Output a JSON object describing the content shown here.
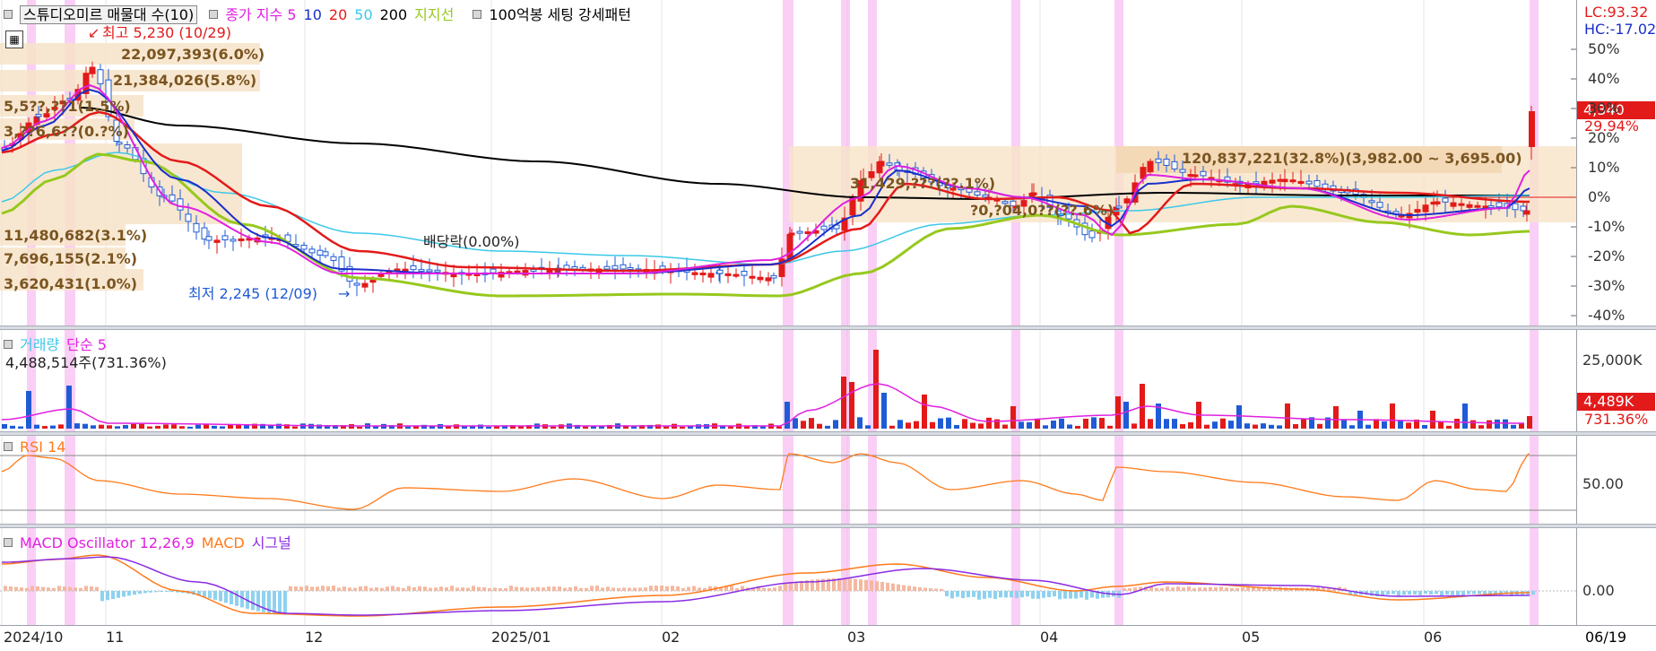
{
  "colors": {
    "up": "#e31a1a",
    "down": "#1f5bd6",
    "ma5": "#e020e0",
    "ma10": "#1a2fcc",
    "ma20": "#e31a1a",
    "ma50": "#3cc8e8",
    "ma200": "#000000",
    "support": "#97c81d",
    "volume_ma": "#e020e0",
    "rsi": "#ff7a1a",
    "macd_osc": "#e020e0",
    "macd": "#ff7a1a",
    "macd_signal": "#8a2be2",
    "highlight": "#f6a7ef",
    "band": "#f7e3c8"
  },
  "price_pane": {
    "title": "스튜디오미르 매물대 수(10)",
    "legend": [
      {
        "label": "종가 지수 5",
        "color": "#e020e0"
      },
      {
        "label": "10",
        "color": "#1a2fcc"
      },
      {
        "label": "20",
        "color": "#e31a1a"
      },
      {
        "label": "50",
        "color": "#3cc8e8"
      },
      {
        "label": "200",
        "color": "#000000"
      },
      {
        "label": "지지선",
        "color": "#97c81d"
      }
    ],
    "legend2": "100억봉 세팅 강세패턴",
    "lc": "LC:93.32",
    "hc": "HC:-17.02",
    "high_label": "최고 5,230 (10/29)",
    "low_label": "최저 2,245 (12/09)",
    "dividend_label": "배당락(0.00%)",
    "price_badge": "4,340",
    "pct_badge": "29.94%",
    "y_ticks": [
      "50%",
      "40%",
      "30%",
      "20%",
      "10%",
      "0%",
      "-10%",
      "-20%",
      "-30%",
      "-40%"
    ],
    "volume_profile": [
      "22,097,393(6.0%)",
      "21,384,026(5.8%)",
      "5,5??,??1(1.5%)",
      "3,??6,6??(0.?%)",
      "11,480,682(3.1%)",
      "7,696,155(2.1%)",
      "3,620,431(1.0%)",
      "120,837,221(32.8%)(3,982.00 ~ 3,695.00)",
      "31,429,???(??.1%)",
      "?0,?04,0??(??.6%)"
    ]
  },
  "volume_pane": {
    "title": "거래량",
    "legend": "단순 5",
    "value_label": "4,488,514주(731.36%)",
    "y_tick": "25,000K",
    "badge": "4,489K",
    "pct": "731.36%"
  },
  "rsi_pane": {
    "title": "RSI 14",
    "y_tick": "50.00"
  },
  "macd_pane": {
    "title": "MACD Oscillator 12,26,9",
    "macd_label": "MACD",
    "signal_label": "시그널",
    "y_tick": "0.00"
  },
  "x_axis": {
    "labels": [
      "2024/10",
      "11",
      "12",
      "2025/01",
      "02",
      "03",
      "04",
      "05",
      "06"
    ],
    "current_date": "06/19"
  },
  "chart_data": {
    "type": "candlestick",
    "x_labels": [
      "2024/10",
      "11",
      "12",
      "2025/01",
      "02",
      "03",
      "04",
      "05",
      "06"
    ],
    "high": {
      "value": 5230,
      "date": "10/29"
    },
    "low": {
      "value": 2245,
      "date": "12/09"
    },
    "last_close": 4340,
    "last_change_pct": 29.94,
    "y_axis": {
      "unit": "%",
      "range": [
        -40,
        50
      ]
    },
    "volume": {
      "last": 4488514,
      "last_pct": 731.36,
      "tick": "25,000K"
    },
    "rsi": {
      "period": 14,
      "tick": 50.0
    },
    "macd": {
      "fast": 12,
      "slow": 26,
      "signal": 9,
      "tick": 0.0
    }
  }
}
